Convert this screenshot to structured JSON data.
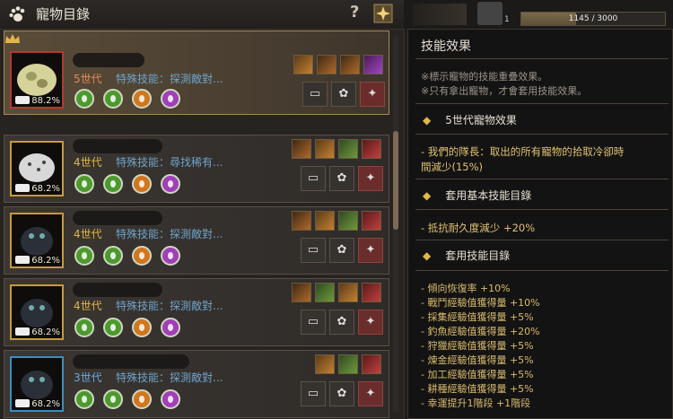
{
  "window": {
    "title": "寵物目錄",
    "help_label": "?"
  },
  "topbar": {
    "level_num": "1",
    "exp_text": "1145 / 3000",
    "exp_fraction": 0.38
  },
  "pets": [
    {
      "generation": "5世代",
      "skill_text": "特殊技能：探測敵對...",
      "percent": "88.2%",
      "frame": "red",
      "selected": true
    },
    {
      "generation": "4世代",
      "skill_text": "特殊技能：尋找稀有...",
      "percent": "68.2%",
      "frame": "gold",
      "selected": false
    },
    {
      "generation": "4世代",
      "skill_text": "特殊技能：探測敵對...",
      "percent": "68.2%",
      "frame": "gold",
      "selected": false
    },
    {
      "generation": "4世代",
      "skill_text": "特殊技能：探測敵對...",
      "percent": "68.2%",
      "frame": "gold",
      "selected": false
    },
    {
      "generation": "3世代",
      "skill_text": "特殊技能：探測敵對...",
      "percent": "68.2%",
      "frame": "blue",
      "selected": false
    }
  ],
  "tooltip": {
    "title": "技能效果",
    "note1": "※標示寵物的技能重疊效果。",
    "note2": "※只有拿出寵物，才會套用技能效果。",
    "sec1": "5世代寵物效果",
    "sec1_line1": "- 我們的隊長：取出的所有寵物的拾取冷卻時",
    "sec1_line2": "間減少(15%)",
    "sec2": "套用基本技能目錄",
    "sec2_line": "- 抵抗耐久度減少 +20%",
    "sec3": "套用技能目錄",
    "effects": [
      "- 傾向恢復率 +10%",
      "- 戰鬥經驗值獲得量 +10%",
      "- 採集經驗值獲得量 +5%",
      "- 釣魚經驗值獲得量 +20%",
      "- 狩獵經驗值獲得量 +5%",
      "- 煉金經驗值獲得量 +5%",
      "- 加工經驗值獲得量 +5%",
      "- 耕種經驗值獲得量 +5%",
      "- 幸運提升1階段 +1階段"
    ]
  }
}
